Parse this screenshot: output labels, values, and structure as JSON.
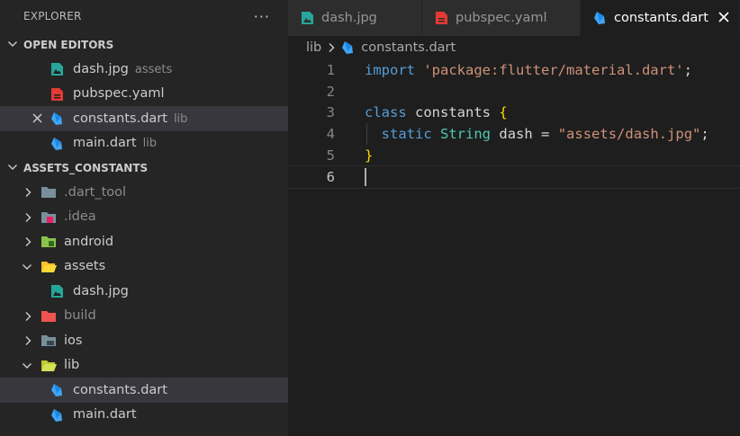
{
  "sidebar": {
    "title": "EXPLORER",
    "more": "···",
    "open_editors": {
      "header": "OPEN EDITORS",
      "items": [
        {
          "name": "dash.jpg",
          "desc": "assets"
        },
        {
          "name": "pubspec.yaml",
          "desc": ""
        },
        {
          "name": "constants.dart",
          "desc": "lib"
        },
        {
          "name": "main.dart",
          "desc": "lib"
        }
      ]
    },
    "project": {
      "header": "ASSETS_CONSTANTS",
      "items": [
        {
          "name": ".dart_tool"
        },
        {
          "name": ".idea"
        },
        {
          "name": "android"
        },
        {
          "name": "assets"
        },
        {
          "name": "dash.jpg"
        },
        {
          "name": "build"
        },
        {
          "name": "ios"
        },
        {
          "name": "lib"
        },
        {
          "name": "constants.dart"
        },
        {
          "name": "main.dart"
        }
      ]
    }
  },
  "tabs": [
    {
      "label": "dash.jpg"
    },
    {
      "label": "pubspec.yaml"
    },
    {
      "label": "constants.dart"
    }
  ],
  "breadcrumb": {
    "folder": "lib",
    "file": "constants.dart"
  },
  "editor": {
    "lines": [
      {
        "n": "1"
      },
      {
        "n": "2"
      },
      {
        "n": "3"
      },
      {
        "n": "4"
      },
      {
        "n": "5"
      },
      {
        "n": "6"
      }
    ],
    "code": {
      "l1_kw": "import",
      "l1_str": "'package:flutter/material.dart'",
      "l1_end": ";",
      "l3_kw": "class",
      "l3_name": "constants",
      "l3_brace": "{",
      "l4_kw": "static",
      "l4_type": "String",
      "l4_var": "dash",
      "l4_eq": "=",
      "l4_str": "\"assets/dash.jpg\"",
      "l4_end": ";",
      "l5_brace": "}"
    }
  },
  "colors": {
    "accent": "#007acc",
    "dart_icon": "#42a5f5",
    "image_icon": "#26a69a",
    "yaml_icon": "#e53935"
  }
}
